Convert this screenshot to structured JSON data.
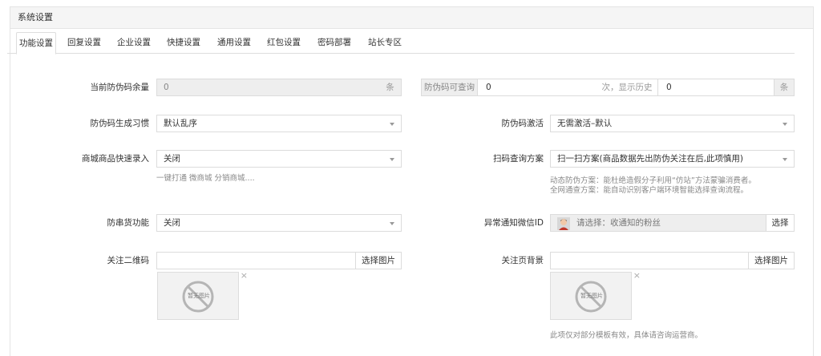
{
  "panel": {
    "title": "系统设置"
  },
  "tabs": [
    {
      "label": "功能设置",
      "active": true
    },
    {
      "label": "回复设置"
    },
    {
      "label": "企业设置"
    },
    {
      "label": "快捷设置"
    },
    {
      "label": "通用设置"
    },
    {
      "label": "红包设置"
    },
    {
      "label": "密码部署"
    },
    {
      "label": "站长专区"
    }
  ],
  "form": {
    "remain": {
      "label": "当前防伪码余量",
      "value": "0",
      "unit": "条"
    },
    "queryable": {
      "prefix": "防伪码可查询",
      "value": "0",
      "middle": "次，显示历史",
      "history_value": "0",
      "unit": "条"
    },
    "habit": {
      "label": "防伪码生成习惯",
      "value": "默认乱序"
    },
    "activate": {
      "label": "防伪码激活",
      "value": "无需激活–默认"
    },
    "quick_entry": {
      "label": "商城商品快速录入",
      "value": "关闭",
      "hint": "一键打通 微商城 分销商城...."
    },
    "scan_plan": {
      "label": "扫码查询方案",
      "value": "扫一扫方案(商品数据先出防伪关注在后,此项慎用)",
      "hint1": "动态防伪方案：能杜绝造假分子利用“仿站”方法蒙骗消费者。",
      "hint2": "全网通查方案：能自动识别客户端环境智能选择查询流程。"
    },
    "anti_dump": {
      "label": "防串货功能",
      "value": "关闭"
    },
    "wechat_notify": {
      "label": "异常通知微信ID",
      "placeholder": "请选择：收通知的粉丝",
      "button": "选择"
    },
    "qrcode": {
      "label": "关注二维码",
      "value": "",
      "button": "选择图片",
      "thumb_text": "暂无图片"
    },
    "follow_bg": {
      "label": "关注页背景",
      "value": "",
      "button": "选择图片",
      "thumb_text": "暂无图片",
      "hint": "此项仅对部分模板有效，具体请咨询运营商。"
    }
  }
}
